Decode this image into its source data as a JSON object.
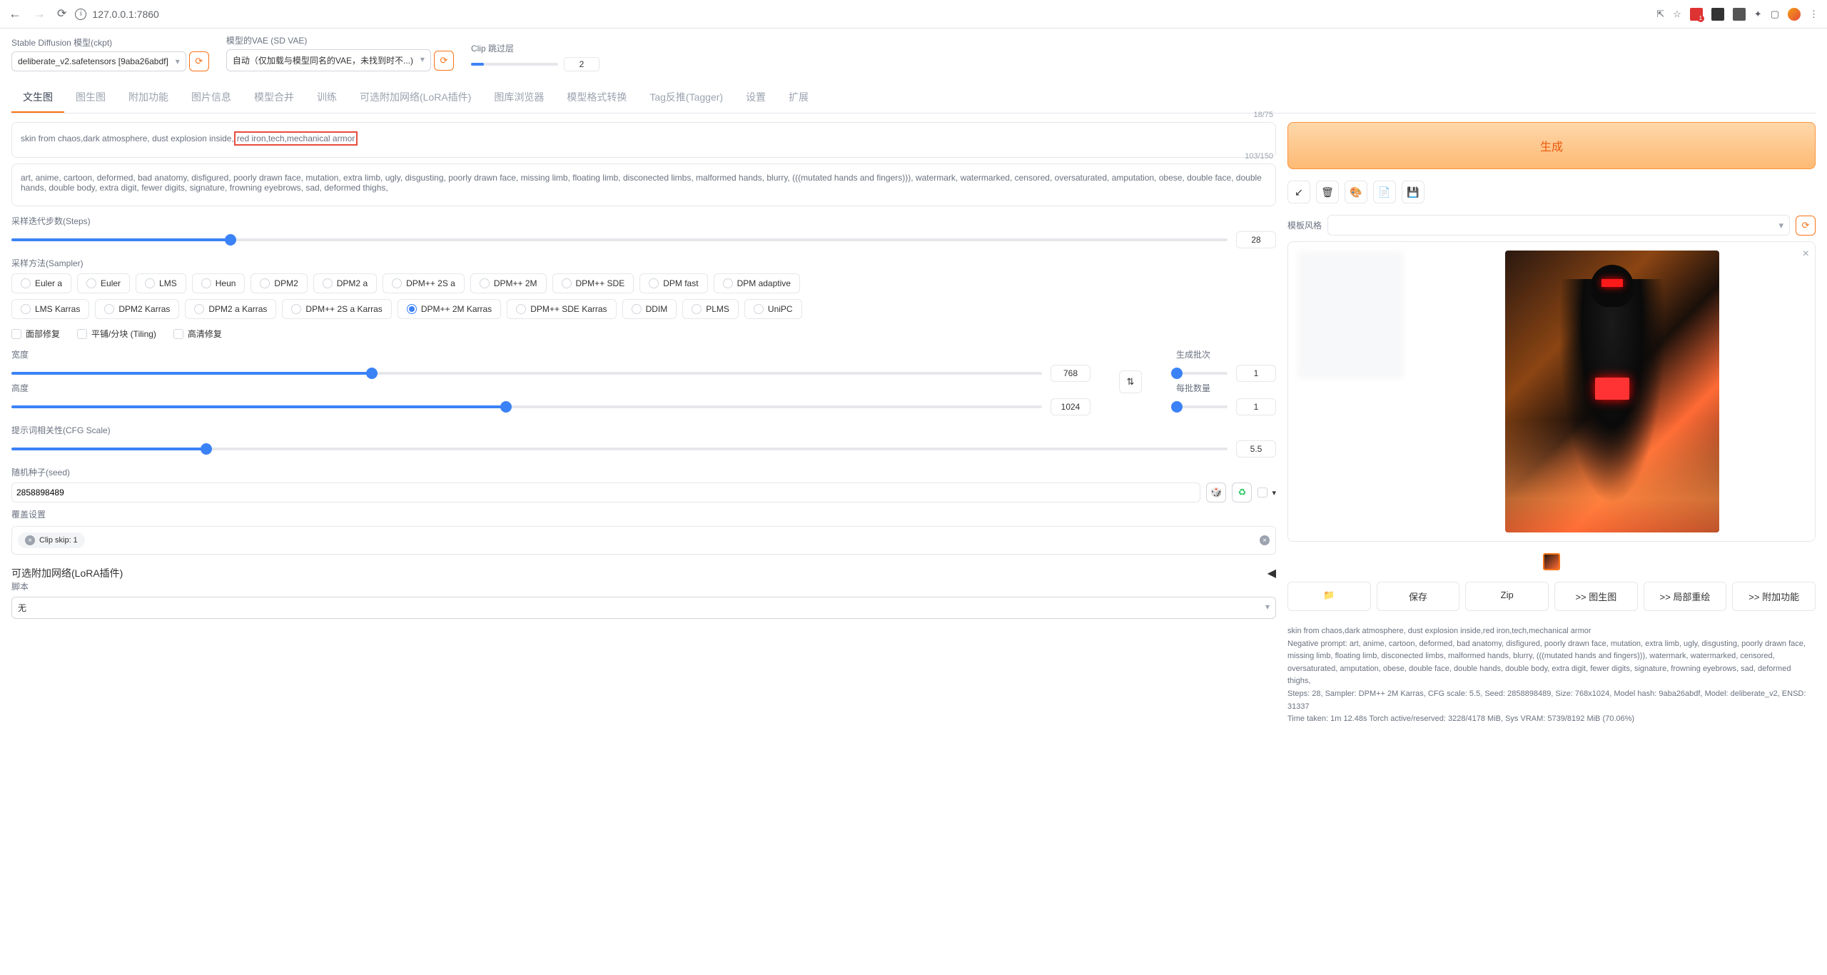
{
  "browser": {
    "url": "127.0.0.1:7860"
  },
  "top": {
    "checkpoint_label": "Stable Diffusion 模型(ckpt)",
    "checkpoint_value": "deliberate_v2.safetensors [9aba26abdf]",
    "vae_label": "模型的VAE (SD VAE)",
    "vae_value": "自动（仅加载与模型同名的VAE，未找到时不...)",
    "clip_label": "Clip 跳过层",
    "clip_value": "2"
  },
  "tabs": [
    "文生图",
    "图生图",
    "附加功能",
    "图片信息",
    "模型合并",
    "训练",
    "可选附加网络(LoRA插件)",
    "图库浏览器",
    "模型格式转换",
    "Tag反推(Tagger)",
    "设置",
    "扩展"
  ],
  "prompt": {
    "text": "skin from chaos,dark atmosphere, dust explosion inside,red iron,tech,mechanical armor",
    "highlight": "red iron,tech,mechanical armor",
    "counter": "18/75"
  },
  "neg_prompt": {
    "text": "art, anime, cartoon, deformed, bad anatomy, disfigured, poorly drawn face, mutation, extra limb, ugly, disgusting, poorly drawn face, missing limb, floating limb, disconected limbs, malformed hands, blurry, (((mutated hands and fingers))), watermark, watermarked, censored, oversaturated, amputation, obese, double face, double hands, double body, extra digit, fewer digits, signature, frowning eyebrows, sad, deformed thighs,",
    "counter": "103/150"
  },
  "generate": "生成",
  "template_label": "模板风格",
  "params": {
    "steps_label": "采样迭代步数(Steps)",
    "steps_value": "28",
    "sampler_label": "采样方法(Sampler)",
    "samplers_row1": [
      "Euler a",
      "Euler",
      "LMS",
      "Heun",
      "DPM2",
      "DPM2 a",
      "DPM++ 2S a",
      "DPM++ 2M",
      "DPM++ SDE",
      "DPM fast",
      "DPM adaptive"
    ],
    "samplers_row2": [
      "LMS Karras",
      "DPM2 Karras",
      "DPM2 a Karras",
      "DPM++ 2S a Karras",
      "DPM++ 2M Karras",
      "DPM++ SDE Karras",
      "DDIM",
      "PLMS",
      "UniPC"
    ],
    "selected_sampler": "DPM++ 2M Karras",
    "face_fix": "面部修复",
    "tiling": "平铺/分块 (Tiling)",
    "hires": "高清修复",
    "width_label": "宽度",
    "width_value": "768",
    "height_label": "高度",
    "height_value": "1024",
    "batch_count_label": "生成批次",
    "batch_count_value": "1",
    "batch_size_label": "每批数量",
    "batch_size_value": "1",
    "cfg_label": "提示词相关性(CFG Scale)",
    "cfg_value": "5.5",
    "seed_label": "随机种子(seed)",
    "seed_value": "2858898489",
    "override_label": "覆盖设置",
    "override_chip": "Clip skip: 1"
  },
  "lora": {
    "header": "可选附加网络(LoRA插件)",
    "script_label": "脚本",
    "script_value": "无"
  },
  "actions": {
    "folder": "📁",
    "save": "保存",
    "zip": "Zip",
    "img2img": ">> 图生图",
    "inpaint": ">> 局部重绘",
    "extras": ">> 附加功能"
  },
  "info": {
    "line1": "skin from chaos,dark atmosphere, dust explosion inside,red iron,tech,mechanical armor",
    "line2": "Negative prompt: art, anime, cartoon, deformed, bad anatomy, disfigured, poorly drawn face, mutation, extra limb, ugly, disgusting, poorly drawn face, missing limb, floating limb, disconected limbs, malformed hands, blurry, (((mutated hands and fingers))), watermark, watermarked, censored, oversaturated, amputation, obese, double face, double hands, double body, extra digit, fewer digits, signature, frowning eyebrows, sad, deformed thighs,",
    "line3": "Steps: 28, Sampler: DPM++ 2M Karras, CFG scale: 5.5, Seed: 2858898489, Size: 768x1024, Model hash: 9aba26abdf, Model: deliberate_v2, ENSD: 31337",
    "line4": "Time taken: 1m 12.48s   Torch active/reserved: 3228/4178 MiB, Sys VRAM: 5739/8192 MiB (70.06%)"
  }
}
